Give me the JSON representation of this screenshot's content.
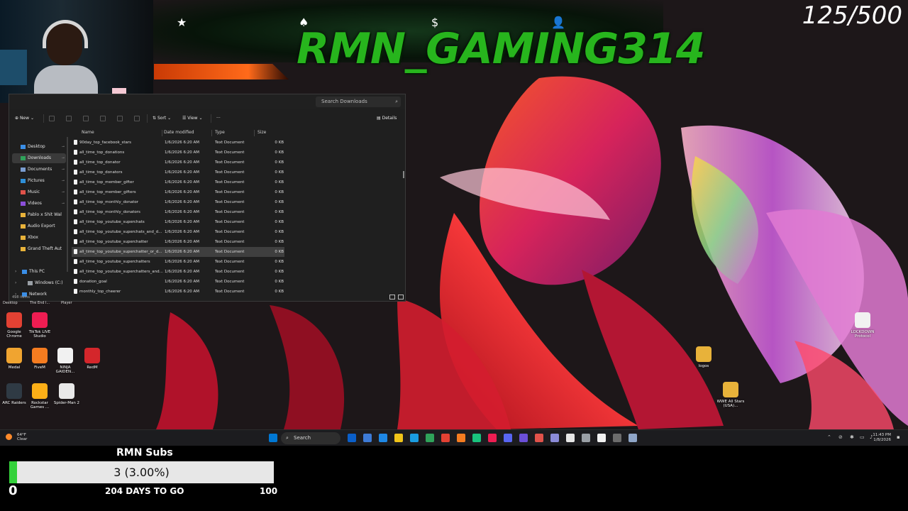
{
  "overlay": {
    "channel_name": "RMN_GAMING314",
    "goal_count": "125/500",
    "banner_icons": [
      "★",
      "♠",
      "$",
      "👤"
    ],
    "subs_goal": {
      "title": "RMN Subs",
      "value": "3 (3.00%)",
      "progress_percent": 3,
      "min": "0",
      "max": "100",
      "days_left": "204 DAYS TO GO"
    }
  },
  "explorer": {
    "search_placeholder": "Search Downloads",
    "toolbar": {
      "new": "New",
      "sort": "Sort",
      "view": "View",
      "more": "···",
      "details": "Details"
    },
    "nav_items": [
      {
        "label": "Desktop",
        "color": "#3a8ee6",
        "active": false,
        "pinned": true
      },
      {
        "label": "Downloads",
        "color": "#2fa35a",
        "active": true,
        "pinned": true
      },
      {
        "label": "Documents",
        "color": "#7a9ccf",
        "active": false,
        "pinned": true
      },
      {
        "label": "Pictures",
        "color": "#2e8fd8",
        "active": false,
        "pinned": true
      },
      {
        "label": "Music",
        "color": "#e0524a",
        "active": false,
        "pinned": true
      },
      {
        "label": "Videos",
        "color": "#8b4fd9",
        "active": false,
        "pinned": true
      },
      {
        "label": "Pablo x Shit Wal",
        "color": "#e8b23a",
        "active": false,
        "pinned": false
      },
      {
        "label": "Audio Export",
        "color": "#e8b23a",
        "active": false,
        "pinned": false
      },
      {
        "label": "Xbox",
        "color": "#e8b23a",
        "active": false,
        "pinned": false
      },
      {
        "label": "Grand Theft Aut",
        "color": "#e8b23a",
        "active": false,
        "pinned": false
      }
    ],
    "tree_items": [
      {
        "label": "This PC",
        "color": "#3a8ee6"
      },
      {
        "label": "Windows (C:)",
        "color": "#9aa0a6"
      },
      {
        "label": "Network",
        "color": "#3a8ee6"
      }
    ],
    "columns": {
      "name": "Name",
      "date": "Date modified",
      "type": "Type",
      "size": "Size"
    },
    "files": [
      {
        "name": "90day_top_facebook_stars",
        "date": "1/6/2026 6:20 AM",
        "type": "Text Document",
        "size": "0 KB"
      },
      {
        "name": "all_time_top_donations",
        "date": "1/6/2026 6:20 AM",
        "type": "Text Document",
        "size": "0 KB"
      },
      {
        "name": "all_time_top_donator",
        "date": "1/6/2026 6:20 AM",
        "type": "Text Document",
        "size": "0 KB"
      },
      {
        "name": "all_time_top_donators",
        "date": "1/6/2026 6:20 AM",
        "type": "Text Document",
        "size": "0 KB"
      },
      {
        "name": "all_time_top_member_gifter",
        "date": "1/6/2026 6:20 AM",
        "type": "Text Document",
        "size": "0 KB"
      },
      {
        "name": "all_time_top_member_gifters",
        "date": "1/6/2026 6:20 AM",
        "type": "Text Document",
        "size": "0 KB"
      },
      {
        "name": "all_time_top_monthly_donator",
        "date": "1/6/2026 6:20 AM",
        "type": "Text Document",
        "size": "0 KB"
      },
      {
        "name": "all_time_top_monthly_donators",
        "date": "1/6/2026 6:20 AM",
        "type": "Text Document",
        "size": "0 KB"
      },
      {
        "name": "all_time_top_youtube_superchats",
        "date": "1/6/2026 6:20 AM",
        "type": "Text Document",
        "size": "0 KB"
      },
      {
        "name": "all_time_top_youtube_superchats_and_d...",
        "date": "1/6/2026 6:20 AM",
        "type": "Text Document",
        "size": "0 KB"
      },
      {
        "name": "all_time_top_youtube_superchatter",
        "date": "1/6/2026 6:20 AM",
        "type": "Text Document",
        "size": "0 KB"
      },
      {
        "name": "all_time_top_youtube_superchatter_or_d...",
        "date": "1/6/2026 6:20 AM",
        "type": "Text Document",
        "size": "0 KB",
        "selected": true
      },
      {
        "name": "all_time_top_youtube_superchatters",
        "date": "1/6/2026 6:20 AM",
        "type": "Text Document",
        "size": "0 KB"
      },
      {
        "name": "all_time_top_youtube_superchatters_and...",
        "date": "1/6/2026 6:20 AM",
        "type": "Text Document",
        "size": "0 KB"
      },
      {
        "name": "donation_goal",
        "date": "1/6/2026 6:20 AM",
        "type": "Text Document",
        "size": "0 KB"
      },
      {
        "name": "monthly_top_cheerer",
        "date": "1/6/2026 6:20 AM",
        "type": "Text Document",
        "size": "0 KB"
      }
    ],
    "status": "498 items"
  },
  "desktop": {
    "icons": [
      {
        "label": "Google Chrome",
        "color": "#e34133"
      },
      {
        "label": "TikTok LIVE Studio",
        "color": "#ee1d52"
      },
      {
        "label": "Medal",
        "color": "#f0a430"
      },
      {
        "label": "FiveM",
        "color": "#f57c20"
      },
      {
        "label": "NINJA GAIDEN...",
        "color": "#f1f1f1"
      },
      {
        "label": "RedM",
        "color": "#d4262b"
      },
      {
        "label": "ARC Raiders",
        "color": "#2f3a44"
      },
      {
        "label": "Rockstar Games ...",
        "color": "#fcaf17"
      },
      {
        "label": "Spider-Man 2",
        "color": "#e9e9e9"
      }
    ],
    "right_icons": [
      {
        "label": "LOCKDOWN Protocol",
        "color": "#f1f1f1"
      },
      {
        "label": "logos",
        "color": "#e8b23a"
      },
      {
        "label": "WWE All Stars (USA)...",
        "color": "#e8b23a"
      }
    ],
    "strip_labels": [
      "Desktop",
      "The End I...",
      "Player"
    ]
  },
  "taskbar": {
    "weather_temp": "64°F",
    "weather_desc": "Clear",
    "search_label": "Search",
    "time": "11:43 PM",
    "date": "1/8/2026",
    "apps": [
      "#0a5fc9",
      "#3d7bd6",
      "#1e88e5",
      "#f0c419",
      "#1a9de1",
      "#2fa35a",
      "#e34133",
      "#f57c20",
      "#19c37d",
      "#ee1d52",
      "#5865f2",
      "#6b4fd8",
      "#e0524a",
      "#8b8bd8",
      "#e6e6e6",
      "#9aa0a6",
      "#f1f1f1",
      "#6c6c6c",
      "#8fa6c8"
    ]
  }
}
